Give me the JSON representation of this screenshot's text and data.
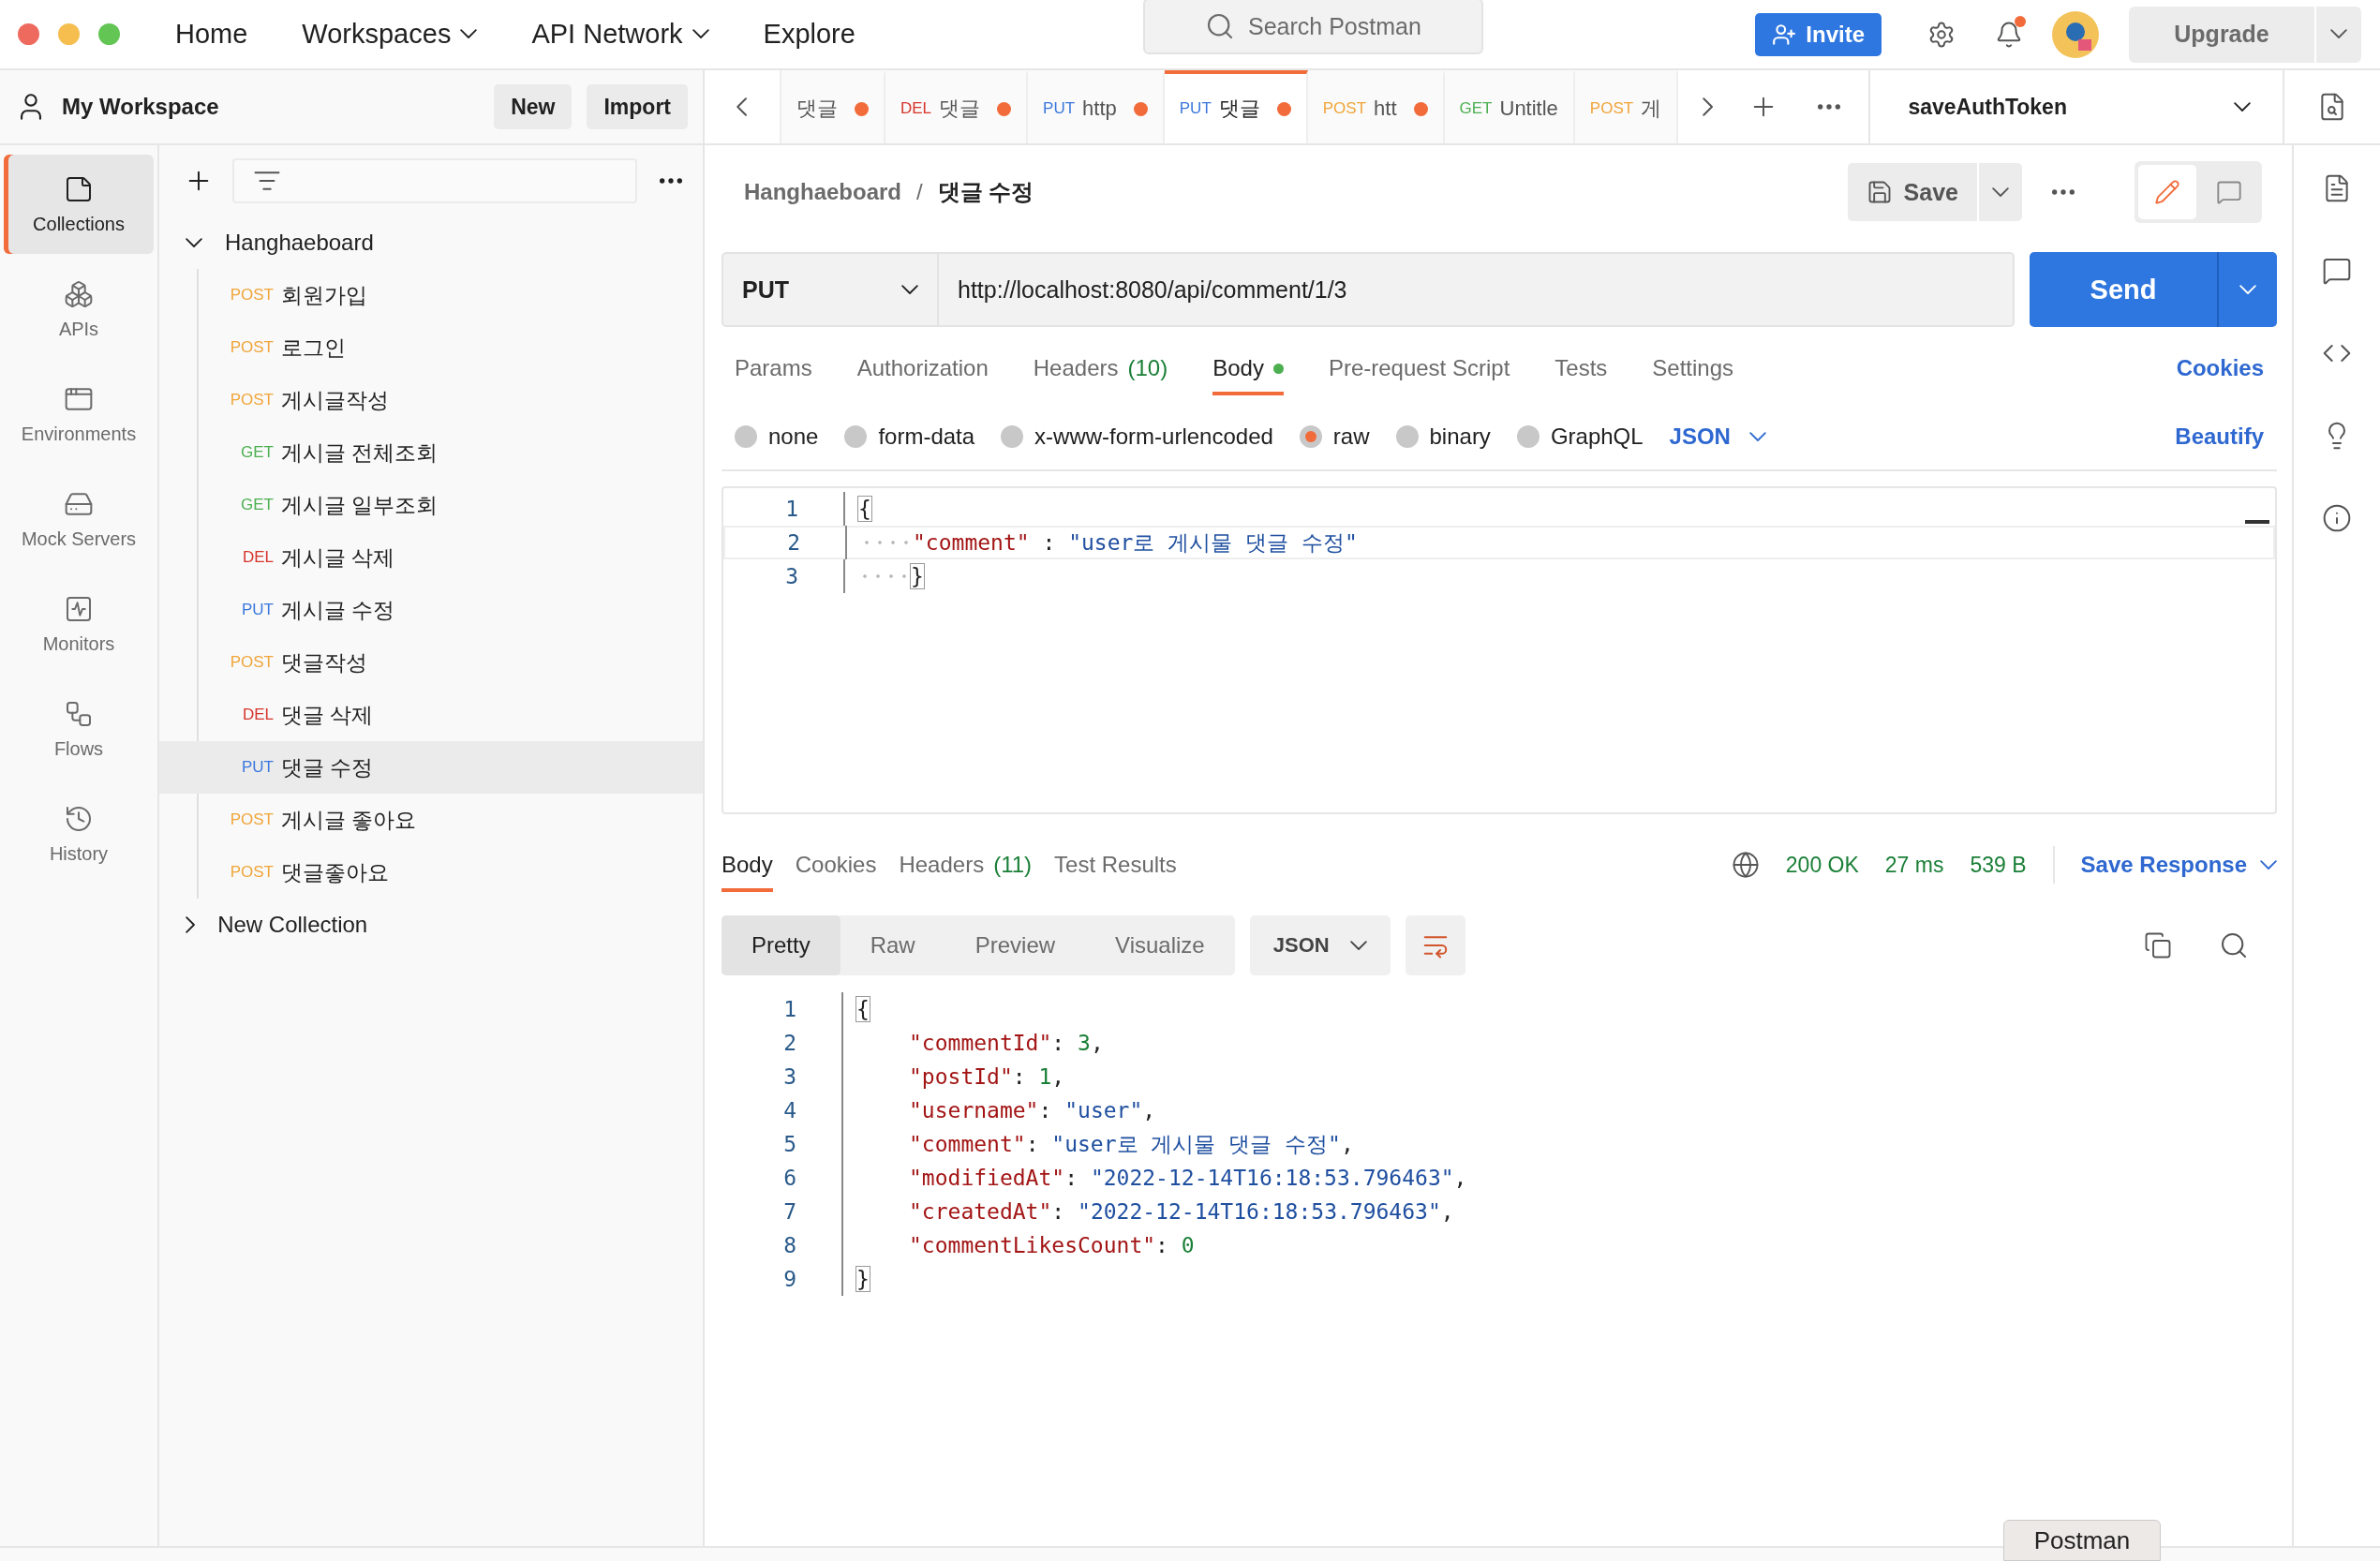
{
  "window_controls": [
    {
      "color": "#ee6a5f"
    },
    {
      "color": "#f5be4f"
    },
    {
      "color": "#62c554"
    }
  ],
  "nav": [
    {
      "label": "Home",
      "dropdown": false
    },
    {
      "label": "Workspaces",
      "dropdown": true
    },
    {
      "label": "API Network",
      "dropdown": true
    },
    {
      "label": "Explore",
      "dropdown": false
    }
  ],
  "search": {
    "placeholder": "Search Postman"
  },
  "invite_button": "Invite",
  "notifications": {
    "unread": true
  },
  "upgrade_button": "Upgrade",
  "workspace": {
    "name": "My Workspace",
    "buttons": [
      "New",
      "Import"
    ]
  },
  "rail": [
    {
      "kind": "collections",
      "label": "Collections",
      "selected": true
    },
    {
      "kind": "apis",
      "label": "APIs",
      "selected": false
    },
    {
      "kind": "environments",
      "label": "Environments",
      "selected": false
    },
    {
      "kind": "mock",
      "label": "Mock Servers",
      "selected": false
    },
    {
      "kind": "monitors",
      "label": "Monitors",
      "selected": false
    },
    {
      "kind": "flows",
      "label": "Flows",
      "selected": false
    },
    {
      "kind": "history",
      "label": "History",
      "selected": false
    }
  ],
  "collections": [
    {
      "name": "Hanghaeboard",
      "expanded": true,
      "children": [
        {
          "method": "POST",
          "name": "회원가입",
          "selected": false
        },
        {
          "method": "POST",
          "name": "로그인",
          "selected": false
        },
        {
          "method": "POST",
          "name": "게시글작성",
          "selected": false
        },
        {
          "method": "GET",
          "name": "게시글 전체조회",
          "selected": false
        },
        {
          "method": "GET",
          "name": "게시글 일부조회",
          "selected": false
        },
        {
          "method": "DEL",
          "name": "게시글 삭제",
          "selected": false
        },
        {
          "method": "PUT",
          "name": "게시글 수정",
          "selected": false
        },
        {
          "method": "POST",
          "name": "댓글작성",
          "selected": false
        },
        {
          "method": "DEL",
          "name": "댓글 삭제",
          "selected": false
        },
        {
          "method": "PUT",
          "name": "댓글 수정",
          "selected": true
        },
        {
          "method": "POST",
          "name": "게시글 좋아요",
          "selected": false
        },
        {
          "method": "POST",
          "name": "댓글좋아요",
          "selected": false
        }
      ]
    },
    {
      "name": "New Collection",
      "expanded": false
    }
  ],
  "tabs": [
    {
      "name": "댓글",
      "unsaved": true,
      "selected": false
    },
    {
      "method": "DEL",
      "name": "댓글",
      "unsaved": true,
      "selected": false
    },
    {
      "method": "PUT",
      "name": "http",
      "unsaved": true,
      "selected": false
    },
    {
      "method": "PUT",
      "name": "댓글",
      "unsaved": true,
      "selected": true
    },
    {
      "method": "POST",
      "name": "htt",
      "unsaved": true,
      "selected": false
    },
    {
      "method": "GET",
      "name": "Untitle",
      "unsaved": false,
      "selected": false
    },
    {
      "method": "POST",
      "name": "게",
      "unsaved": false,
      "selected": false
    }
  ],
  "environment": {
    "name": "saveAuthToken"
  },
  "breadcrumb": {
    "collection": "Hanghaeboard",
    "separator": "/",
    "request": "댓글 수정"
  },
  "save_button": "Save",
  "request": {
    "method": "PUT",
    "url": "http://localhost:8080/api/comment/1/3",
    "send_button": "Send"
  },
  "request_tabs": [
    {
      "label": "Params",
      "selected": false,
      "has_content": false
    },
    {
      "label": "Authorization",
      "selected": false,
      "has_content": false
    },
    {
      "label": "Headers",
      "count": "(10)",
      "selected": false,
      "has_content": false
    },
    {
      "label": "Body",
      "selected": true,
      "has_content": true
    },
    {
      "label": "Pre-request Script",
      "selected": false,
      "has_content": false
    },
    {
      "label": "Tests",
      "selected": false,
      "has_content": false
    },
    {
      "label": "Settings",
      "selected": false,
      "has_content": false
    }
  ],
  "cookies_link": "Cookies",
  "body_types": [
    {
      "label": "none",
      "selected": false
    },
    {
      "label": "form-data",
      "selected": false
    },
    {
      "label": "x-www-form-urlencoded",
      "selected": false
    },
    {
      "label": "raw",
      "selected": true
    },
    {
      "label": "binary",
      "selected": false
    },
    {
      "label": "GraphQL",
      "selected": false
    }
  ],
  "body_format": "JSON",
  "beautify_link": "Beautify",
  "request_body": [
    {
      "number": "1",
      "indented": false,
      "tokens": [
        {
          "kind": "bracket",
          "text": "{"
        }
      ]
    },
    {
      "number": "2",
      "indented": true,
      "tokens": [
        {
          "kind": "key",
          "text": "\"comment\""
        },
        {
          "kind": "punct",
          "text": " : "
        },
        {
          "kind": "string",
          "text": "\"user로 게시물 댓글 수정\""
        }
      ]
    },
    {
      "number": "3",
      "indented": true,
      "tokens": [
        {
          "kind": "bracket",
          "text": "}"
        }
      ]
    }
  ],
  "response_tabs": [
    {
      "label": "Body",
      "selected": true
    },
    {
      "label": "Cookies",
      "selected": false
    },
    {
      "label": "Headers",
      "count": "(11)",
      "selected": false
    },
    {
      "label": "Test Results",
      "selected": false
    }
  ],
  "response_status": {
    "status": "200 OK",
    "time": "27 ms",
    "size": "539 B"
  },
  "save_response": "Save Response",
  "view_modes": [
    {
      "label": "Pretty",
      "selected": true
    },
    {
      "label": "Raw",
      "selected": false
    },
    {
      "label": "Preview",
      "selected": false
    },
    {
      "label": "Visualize",
      "selected": false
    }
  ],
  "response_format": "JSON",
  "response_body": [
    {
      "number": "1",
      "indented": false,
      "tokens": [
        {
          "kind": "bracket",
          "text": "{"
        }
      ]
    },
    {
      "number": "2",
      "indented": true,
      "tokens": [
        {
          "kind": "key",
          "text": "\"commentId\""
        },
        {
          "kind": "punct",
          "text": ": "
        },
        {
          "kind": "number",
          "text": "3"
        },
        {
          "kind": "punct",
          "text": ","
        }
      ]
    },
    {
      "number": "3",
      "indented": true,
      "tokens": [
        {
          "kind": "key",
          "text": "\"postId\""
        },
        {
          "kind": "punct",
          "text": ": "
        },
        {
          "kind": "number",
          "text": "1"
        },
        {
          "kind": "punct",
          "text": ","
        }
      ]
    },
    {
      "number": "4",
      "indented": true,
      "tokens": [
        {
          "kind": "key",
          "text": "\"username\""
        },
        {
          "kind": "punct",
          "text": ": "
        },
        {
          "kind": "string",
          "text": "\"user\""
        },
        {
          "kind": "punct",
          "text": ","
        }
      ]
    },
    {
      "number": "5",
      "indented": true,
      "tokens": [
        {
          "kind": "key",
          "text": "\"comment\""
        },
        {
          "kind": "punct",
          "text": ": "
        },
        {
          "kind": "string",
          "text": "\"user로 게시물 댓글 수정\""
        },
        {
          "kind": "punct",
          "text": ","
        }
      ]
    },
    {
      "number": "6",
      "indented": true,
      "tokens": [
        {
          "kind": "key",
          "text": "\"modifiedAt\""
        },
        {
          "kind": "punct",
          "text": ": "
        },
        {
          "kind": "string",
          "text": "\"2022-12-14T16:18:53.796463\""
        },
        {
          "kind": "punct",
          "text": ","
        }
      ]
    },
    {
      "number": "7",
      "indented": true,
      "tokens": [
        {
          "kind": "key",
          "text": "\"createdAt\""
        },
        {
          "kind": "punct",
          "text": ": "
        },
        {
          "kind": "string",
          "text": "\"2022-12-14T16:18:53.796463\""
        },
        {
          "kind": "punct",
          "text": ","
        }
      ]
    },
    {
      "number": "8",
      "indented": true,
      "tokens": [
        {
          "kind": "key",
          "text": "\"commentLikesCount\""
        },
        {
          "kind": "punct",
          "text": ": "
        },
        {
          "kind": "number",
          "text": "0"
        }
      ]
    },
    {
      "number": "9",
      "indented": false,
      "tokens": [
        {
          "kind": "bracket",
          "text": "}"
        }
      ]
    }
  ],
  "tooltip": "Postman"
}
